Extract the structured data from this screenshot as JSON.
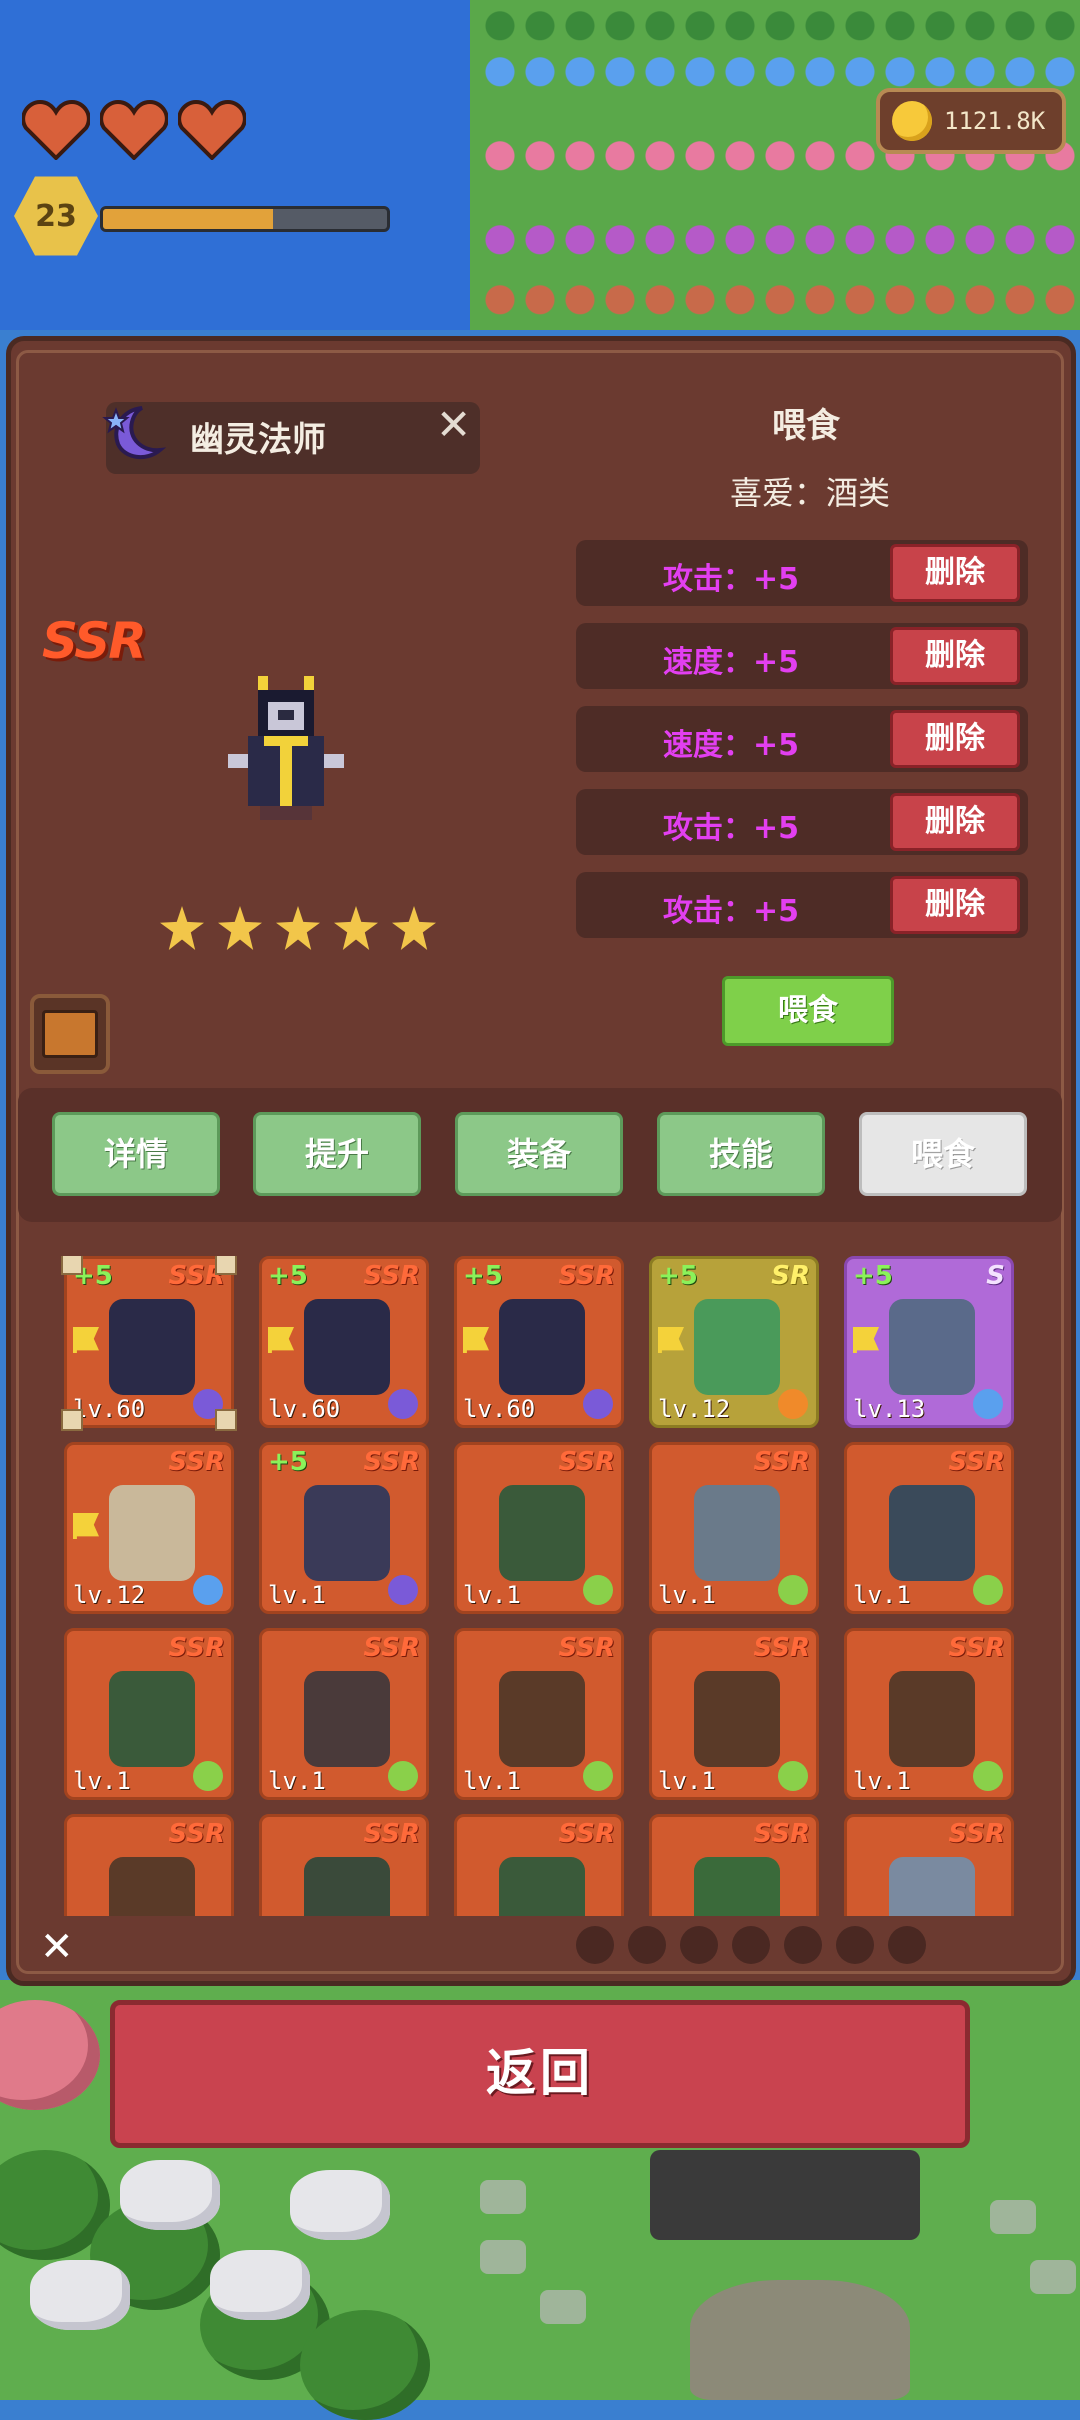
{
  "hud": {
    "hearts": 3,
    "player_level": "23",
    "xp_progress": 0.6,
    "coins": "1121.8K"
  },
  "character": {
    "name": "幽灵法师",
    "rarity": "SSR",
    "stars": 5
  },
  "feed_panel": {
    "title": "喂食",
    "favorite": "喜爱：酒类",
    "stats": [
      {
        "label": "攻击：+5",
        "delete": "删除"
      },
      {
        "label": "速度：+5",
        "delete": "删除"
      },
      {
        "label": "速度：+5",
        "delete": "删除"
      },
      {
        "label": "攻击：+5",
        "delete": "删除"
      },
      {
        "label": "攻击：+5",
        "delete": "删除"
      }
    ],
    "feed_button": "喂食"
  },
  "tabs": [
    "详情",
    "提升",
    "装备",
    "技能",
    "喂食"
  ],
  "active_tab": 4,
  "cards": [
    {
      "rarity": "SSR",
      "bonus": "+5",
      "level": "lv.60",
      "flag": true,
      "element": "moon",
      "selected": true
    },
    {
      "rarity": "SSR",
      "bonus": "+5",
      "level": "lv.60",
      "flag": true,
      "element": "moon"
    },
    {
      "rarity": "SSR",
      "bonus": "+5",
      "level": "lv.60",
      "flag": true,
      "element": "moon"
    },
    {
      "rarity": "SR",
      "bonus": "+5",
      "level": "lv.12",
      "flag": true,
      "element": "sun"
    },
    {
      "rarity": "S",
      "bonus": "+5",
      "level": "lv.13",
      "flag": true,
      "element": "water"
    },
    {
      "rarity": "SSR",
      "bonus": "",
      "level": "lv.12",
      "flag": true,
      "element": "water"
    },
    {
      "rarity": "SSR",
      "bonus": "+5",
      "level": "lv.1",
      "flag": false,
      "element": "moon"
    },
    {
      "rarity": "SSR",
      "bonus": "",
      "level": "lv.1",
      "flag": false,
      "element": "leaf"
    },
    {
      "rarity": "SSR",
      "bonus": "",
      "level": "lv.1",
      "flag": false,
      "element": "leaf"
    },
    {
      "rarity": "SSR",
      "bonus": "",
      "level": "lv.1",
      "flag": false,
      "element": "leaf"
    },
    {
      "rarity": "SSR",
      "bonus": "",
      "level": "lv.1",
      "flag": false,
      "element": "leaf"
    },
    {
      "rarity": "SSR",
      "bonus": "",
      "level": "lv.1",
      "flag": false,
      "element": "leaf"
    },
    {
      "rarity": "SSR",
      "bonus": "",
      "level": "lv.1",
      "flag": false,
      "element": "leaf"
    },
    {
      "rarity": "SSR",
      "bonus": "",
      "level": "lv.1",
      "flag": false,
      "element": "leaf"
    },
    {
      "rarity": "SSR",
      "bonus": "",
      "level": "lv.1",
      "flag": false,
      "element": "leaf"
    },
    {
      "rarity": "SSR",
      "bonus": "",
      "level": "",
      "flag": false,
      "element": ""
    },
    {
      "rarity": "SSR",
      "bonus": "",
      "level": "",
      "flag": false,
      "element": ""
    },
    {
      "rarity": "SSR",
      "bonus": "",
      "level": "",
      "flag": false,
      "element": ""
    },
    {
      "rarity": "SSR",
      "bonus": "",
      "level": "",
      "flag": false,
      "element": ""
    },
    {
      "rarity": "SSR",
      "bonus": "",
      "level": "",
      "flag": false,
      "element": ""
    }
  ],
  "element_filters": [
    "fire-icon",
    "leaf-icon",
    "water-icon",
    "shield-icon",
    "flame-icon",
    "gear-icon",
    "moon-icon"
  ],
  "close_symbol": "✕",
  "back_button": "返回",
  "colors": {
    "panel": "#6b3a30",
    "ssr_card": "#d15a2e",
    "sr_card": "#b7a23a",
    "s_card": "#b06ad8",
    "stat_text": "#e23ff0",
    "delete_button": "#c8434a",
    "feed_button": "#7fd04a",
    "tab": "#8cc888",
    "back_button": "#c9434f"
  }
}
